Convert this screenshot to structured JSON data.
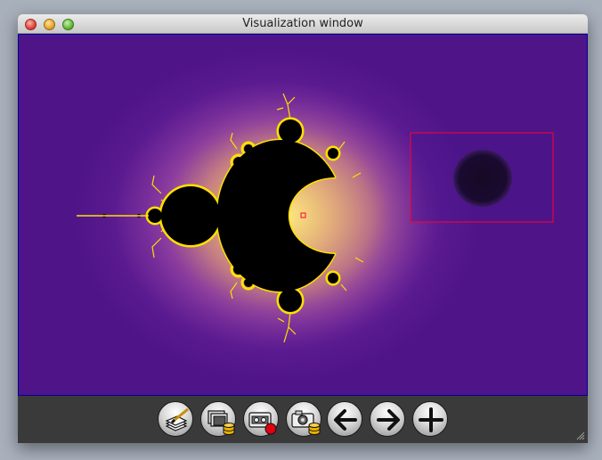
{
  "window": {
    "title": "Visualization window"
  },
  "toolbar": {
    "buttons": [
      {
        "icon": "paint-palette-icon"
      },
      {
        "icon": "copy-to-database-icon"
      },
      {
        "icon": "record-icon"
      },
      {
        "icon": "camera-database-icon"
      },
      {
        "icon": "arrow-left-icon"
      },
      {
        "icon": "arrow-right-icon"
      },
      {
        "icon": "plus-icon"
      }
    ]
  },
  "colors": {
    "background": "#541690",
    "set": "#000000",
    "fringe": "#ffe000",
    "selection": "#ff0030",
    "frame": "#0000a0"
  }
}
